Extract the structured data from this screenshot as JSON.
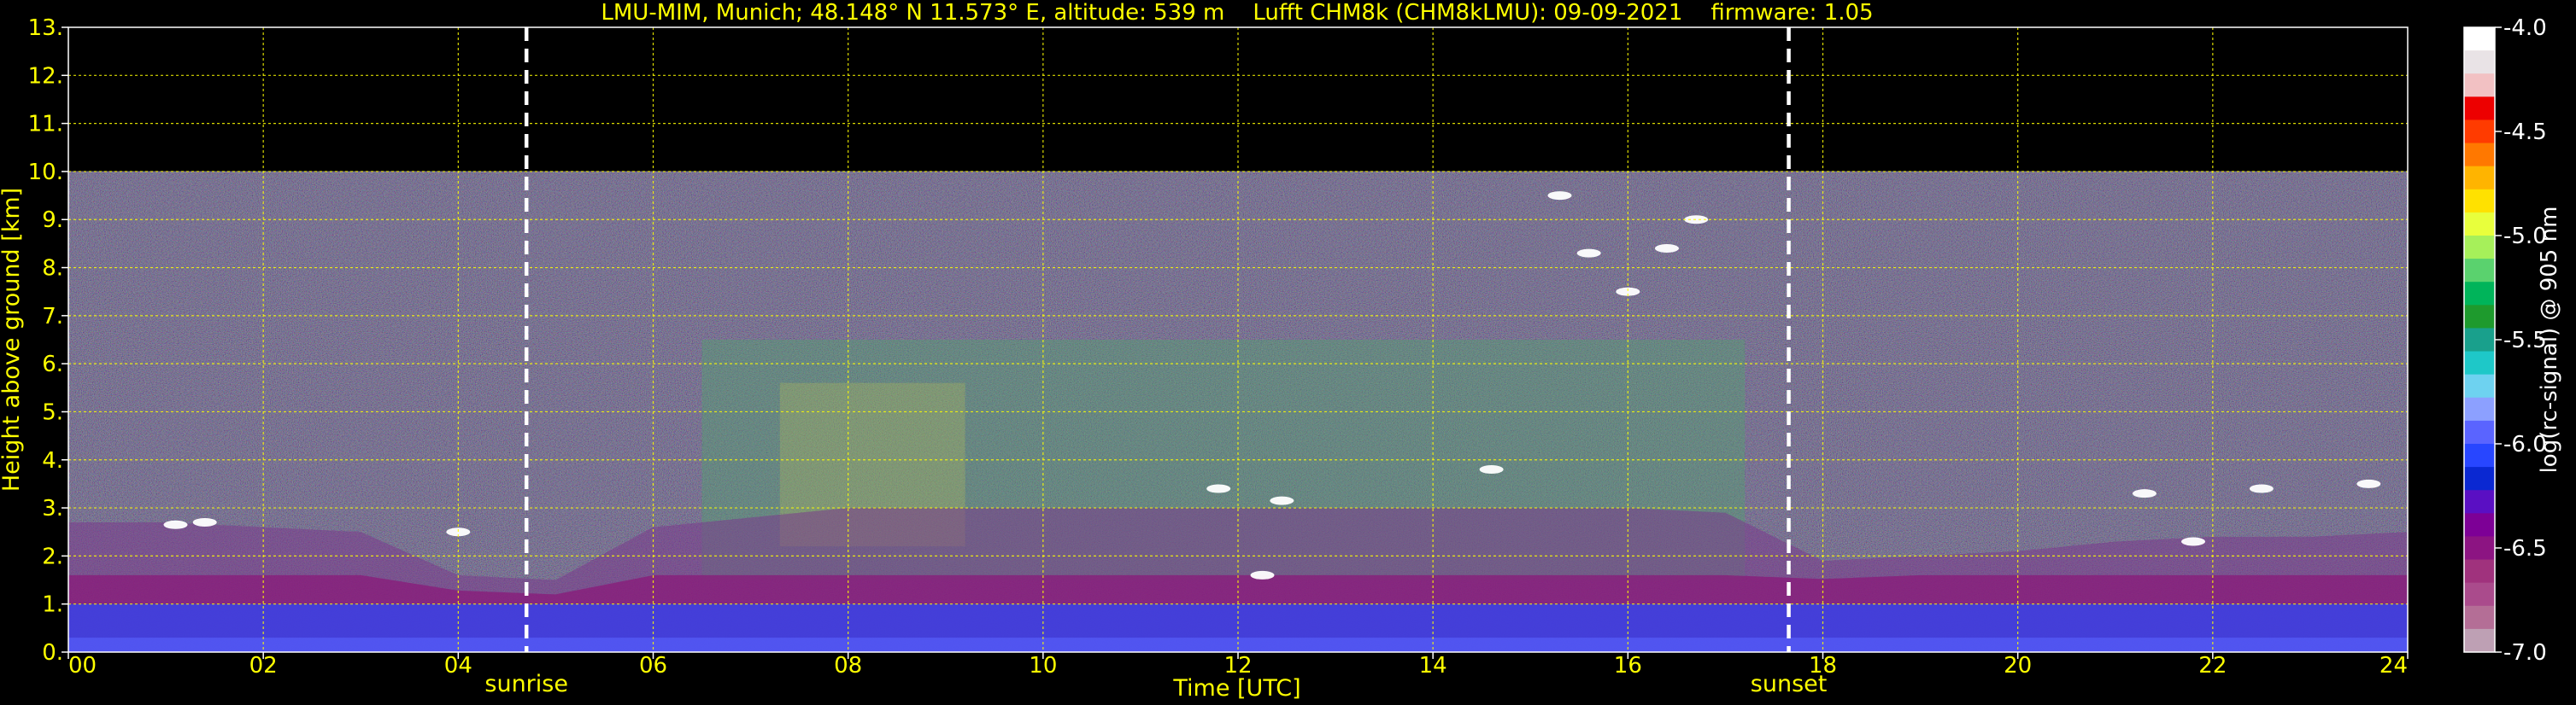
{
  "chart_data": {
    "type": "heatmap",
    "title": "LMU-MIM, Munich; 48.148° N 11.573° E, altitude: 539 m    Lufft CHM8k (CHM8kLMU): 09-09-2021    firmware: 1.05",
    "xlabel": "Time [UTC]",
    "ylabel": "Height above ground [km]",
    "xlim": [
      0,
      24
    ],
    "ylim": [
      0,
      13
    ],
    "x_ticks": [
      "00",
      "02",
      "04",
      "06",
      "08",
      "10",
      "12",
      "14",
      "16",
      "18",
      "20",
      "22",
      "24"
    ],
    "y_ticks": [
      "0.",
      "1.",
      "2.",
      "3.",
      "4.",
      "5.",
      "6.",
      "7.",
      "8.",
      "9.",
      "10.",
      "11.",
      "12.",
      "13."
    ],
    "grid": true,
    "data_top_km": 10,
    "events": [
      {
        "label": "sunrise",
        "time_h": 4.7
      },
      {
        "label": "sunset",
        "time_h": 17.65
      }
    ],
    "colorbar": {
      "label": "log(rc-signal) @ 905 nm",
      "range": [
        -7.0,
        -4.0
      ],
      "ticks": [
        "-4.0",
        "-4.5",
        "-5.0",
        "-5.5",
        "-6.0",
        "-6.5",
        "-7.0"
      ],
      "colors": [
        "#ffffff",
        "#e9e3e6",
        "#f2c1c3",
        "#ed0000",
        "#ff3b00",
        "#ff7800",
        "#ffb400",
        "#ffe100",
        "#e8ff3c",
        "#a6f05a",
        "#5ad26e",
        "#00b45a",
        "#1e9a2d",
        "#19a08c",
        "#1ec8c8",
        "#6ed2f0",
        "#8ca0ff",
        "#5a64ff",
        "#2846ff",
        "#0a28d2",
        "#5a0fc3",
        "#7d0096",
        "#8c1482",
        "#a0327d",
        "#aa4b8c",
        "#b46e96",
        "#bea0b4"
      ]
    },
    "layers": {
      "boundary_layer_top_km": [
        2.7,
        2.7,
        2.6,
        2.5,
        1.6,
        1.5,
        2.6,
        2.8,
        3.0,
        3.0,
        3.0,
        3.0,
        3.0,
        3.0,
        3.0,
        3.0,
        3.0,
        2.9,
        1.9,
        2.0,
        2.1,
        2.3,
        2.4,
        2.4,
        2.5
      ]
    },
    "cloud_patches": [
      {
        "time_h": 1.1,
        "height_km": 2.65
      },
      {
        "time_h": 1.4,
        "height_km": 2.7
      },
      {
        "time_h": 4.0,
        "height_km": 2.5
      },
      {
        "time_h": 11.8,
        "height_km": 3.4
      },
      {
        "time_h": 12.45,
        "height_km": 3.15
      },
      {
        "time_h": 12.25,
        "height_km": 1.6
      },
      {
        "time_h": 14.6,
        "height_km": 3.8
      },
      {
        "time_h": 15.3,
        "height_km": 9.5
      },
      {
        "time_h": 15.6,
        "height_km": 8.3
      },
      {
        "time_h": 16.0,
        "height_km": 7.5
      },
      {
        "time_h": 16.4,
        "height_km": 8.4
      },
      {
        "time_h": 16.7,
        "height_km": 9.0
      },
      {
        "time_h": 21.3,
        "height_km": 3.3
      },
      {
        "time_h": 22.5,
        "height_km": 3.4
      },
      {
        "time_h": 23.6,
        "height_km": 3.5
      },
      {
        "time_h": 21.8,
        "height_km": 2.3
      }
    ]
  }
}
